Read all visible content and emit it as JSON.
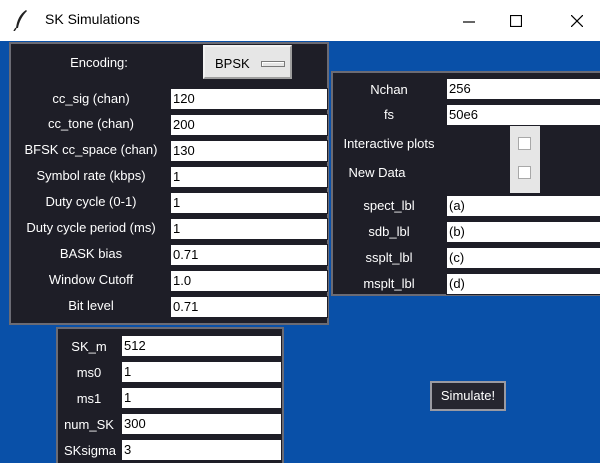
{
  "window": {
    "title": "SK Simulations",
    "icon": "feather-icon",
    "controls": {
      "minimize": "minimize-icon",
      "maximize": "maximize-icon",
      "close": "close-icon"
    }
  },
  "colors": {
    "background": "#0950a8",
    "panel": "#1e1e27",
    "field": "#ffffff"
  },
  "encoding": {
    "label": "Encoding:",
    "value": "BPSK"
  },
  "params": [
    {
      "label": "cc_sig (chan)",
      "value": "120"
    },
    {
      "label": "cc_tone (chan)",
      "value": "200"
    },
    {
      "label": "BFSK cc_space (chan)",
      "value": "130"
    },
    {
      "label": "Symbol rate (kbps)",
      "value": "1"
    },
    {
      "label": "Duty cycle (0-1)",
      "value": "1"
    },
    {
      "label": "Duty cycle period (ms)",
      "value": "1"
    },
    {
      "label": "BASK bias",
      "value": "0.71"
    },
    {
      "label": "Window Cutoff",
      "value": "1.0"
    },
    {
      "label": "Bit level",
      "value": "0.71"
    }
  ],
  "right_panel": {
    "nchan": {
      "label": "Nchan",
      "value": "256"
    },
    "fs": {
      "label": "fs",
      "value": "50e6"
    },
    "interactive_plots": {
      "label": "Interactive plots",
      "checked": false
    },
    "new_data": {
      "label": "New Data",
      "checked": false
    },
    "labels": [
      {
        "label": "spect_lbl",
        "value": "(a)"
      },
      {
        "label": "sdb_lbl",
        "value": "(b)"
      },
      {
        "label": "ssplt_lbl",
        "value": "(c)"
      },
      {
        "label": "msplt_lbl",
        "value": "(d)"
      }
    ]
  },
  "sk": [
    {
      "label": "SK_m",
      "value": "512"
    },
    {
      "label": "ms0",
      "value": "1"
    },
    {
      "label": "ms1",
      "value": "1"
    },
    {
      "label": "num_SK",
      "value": "300"
    },
    {
      "label": "SKsigma",
      "value": "3"
    }
  ],
  "simulate_button": "Simulate!"
}
